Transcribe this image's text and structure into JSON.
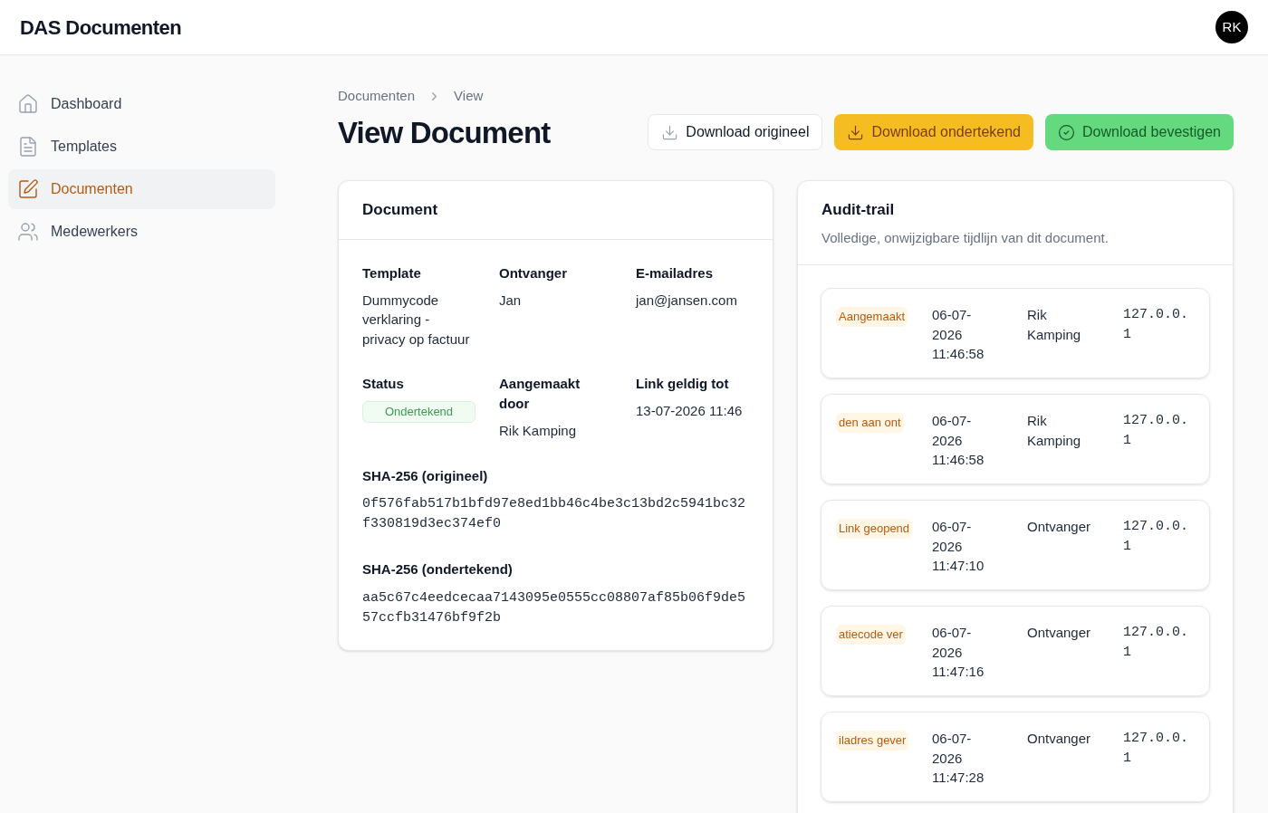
{
  "header": {
    "title": "DAS Documenten",
    "avatar": "RK"
  },
  "sidebar": {
    "items": [
      {
        "label": "Dashboard",
        "selected": false
      },
      {
        "label": "Templates",
        "selected": false
      },
      {
        "label": "Documenten",
        "selected": true
      },
      {
        "label": "Medewerkers",
        "selected": false
      }
    ]
  },
  "breadcrumb": [
    "Documenten",
    "View"
  ],
  "page_title": "View Document",
  "actions": [
    {
      "label": "Download origineel",
      "kind": "outline"
    },
    {
      "label": "Download ondertekend",
      "kind": "warning"
    },
    {
      "label": "Download bevestigen",
      "kind": "success"
    }
  ],
  "document": {
    "title": "Document",
    "fields": [
      {
        "label": "Template",
        "value": "Dummycode verklaring - privacy op factuur",
        "kind": "text"
      },
      {
        "label": "Ontvanger",
        "value": "Jan",
        "kind": "text"
      },
      {
        "label": "E-mailadres",
        "value": "jan@jansen.com",
        "kind": "text"
      },
      {
        "label": "Status",
        "value": "Ondertekend",
        "kind": "badge"
      },
      {
        "label": "Aangemaakt door",
        "value": "Rik Kamping",
        "kind": "text"
      },
      {
        "label": "Link geldig tot",
        "value": "13-07-2026 11:46",
        "kind": "text"
      }
    ],
    "hashes": [
      {
        "label": "SHA-256 (origineel)",
        "value": "0f576fab517b1bfd97e8ed1bb46c4be3c13bd2c5941bc32f330819d3ec374ef0"
      },
      {
        "label": "SHA-256 (ondertekend)",
        "value": "aa5c67c4eedcecaa7143095e0555cc08807af85b06f9de557ccfb31476bf9f2b"
      }
    ]
  },
  "audit": {
    "title": "Audit-trail",
    "subtitle": "Volledige, onwijzigbare tijdlijn van dit document.",
    "entries": [
      {
        "event": "Aangemaakt",
        "date": "06-07-2026 11:46:58",
        "actor": "Rik Kamping",
        "ip": "127.0.0.1"
      },
      {
        "event": "den aan ont",
        "date": "06-07-2026 11:46:58",
        "actor": "Rik Kamping",
        "ip": "127.0.0.1"
      },
      {
        "event": "Link geopend",
        "date": "06-07-2026 11:47:10",
        "actor": "Ontvanger",
        "ip": "127.0.0.1"
      },
      {
        "event": "atiecode ver",
        "date": "06-07-2026 11:47:16",
        "actor": "Ontvanger",
        "ip": "127.0.0.1"
      },
      {
        "event": "iladres gever",
        "date": "06-07-2026 11:47:28",
        "actor": "Ontvanger",
        "ip": "127.0.0.1"
      }
    ]
  }
}
